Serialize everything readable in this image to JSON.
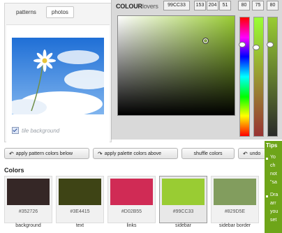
{
  "tabs": [
    "patterns",
    "photos"
  ],
  "tile_background_label": "tile background",
  "picker": {
    "brand_bold": "COLOUR",
    "brand_light": "lovers",
    "hex": "99CC33",
    "rgb": [
      "153",
      "204",
      "51"
    ],
    "hsv": [
      "80",
      "75",
      "80"
    ]
  },
  "buttons": {
    "apply_pattern": "apply pattern colors below",
    "apply_palette": "apply palette colors above",
    "shuffle": "shuffle colors",
    "undo": "undo"
  },
  "colors_title": "Colors",
  "swatches": [
    {
      "hex": "#352726",
      "color": "#352726",
      "label": "background"
    },
    {
      "hex": "#3E4415",
      "color": "#3E4415",
      "label": "text"
    },
    {
      "hex": "#D02B55",
      "color": "#D02B55",
      "label": "links"
    },
    {
      "hex": "#99CC33",
      "color": "#99CC33",
      "label": "sidebar"
    },
    {
      "hex": "#829D5E",
      "color": "#829D5E",
      "label": "sidebar border"
    }
  ],
  "tips": {
    "title": "Tips",
    "lines": [
      "Yo",
      "ch",
      "not",
      "\"sa",
      "Dra",
      "arr",
      "you",
      "set"
    ]
  }
}
